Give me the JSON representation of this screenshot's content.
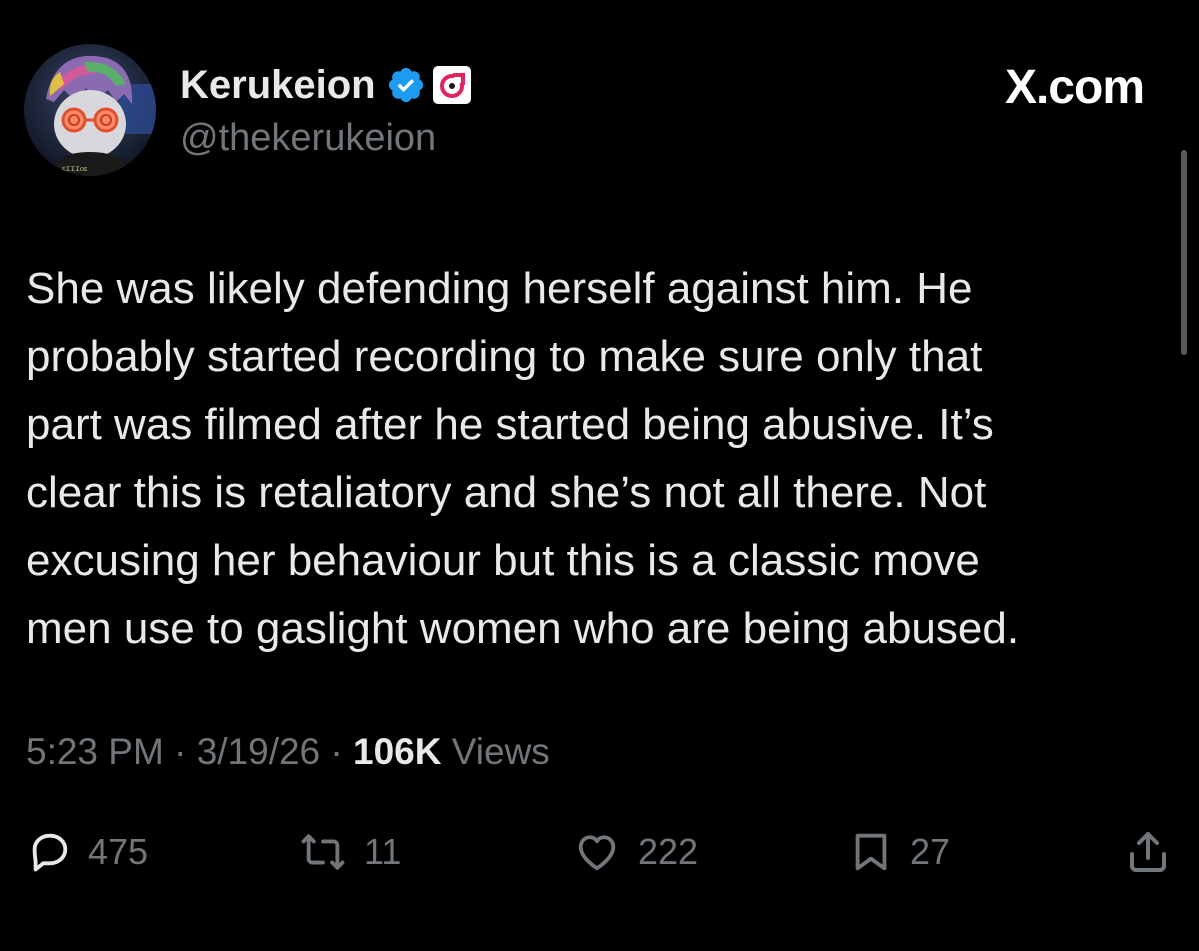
{
  "header": {
    "display_name": "Kerukeion",
    "handle": "@thekerukeion",
    "site_label": "X.com",
    "avatar_badge_text": "ᴇɪɪɪᴏᴇ"
  },
  "tweet": {
    "text": "She was likely defending herself against him. He\nprobably started recording to make sure only that\npart was filmed after he started being abusive. It’s\nclear this is retaliatory and she’s not all there. Not\nexcusing her behaviour but this is a classic move\nmen use to gaslight women who are being abused.",
    "time": "5:23 PM",
    "date": "3/19/26",
    "separator": "·",
    "views_count": "106K",
    "views_label": "Views"
  },
  "actions": {
    "replies": "475",
    "reposts": "11",
    "likes": "222",
    "bookmarks": "27"
  },
  "icons": {
    "verified": "verified-badge-icon",
    "affiliate": "affiliate-logo-icon",
    "reply": "reply-icon",
    "repost": "repost-icon",
    "like": "heart-icon",
    "bookmark": "bookmark-icon",
    "share": "share-icon"
  },
  "colors": {
    "background": "#000000",
    "primary_text": "#e7e9ea",
    "secondary_text": "#71767b",
    "verified_blue": "#1d9bf0",
    "affiliate_red": "#e0245e"
  }
}
